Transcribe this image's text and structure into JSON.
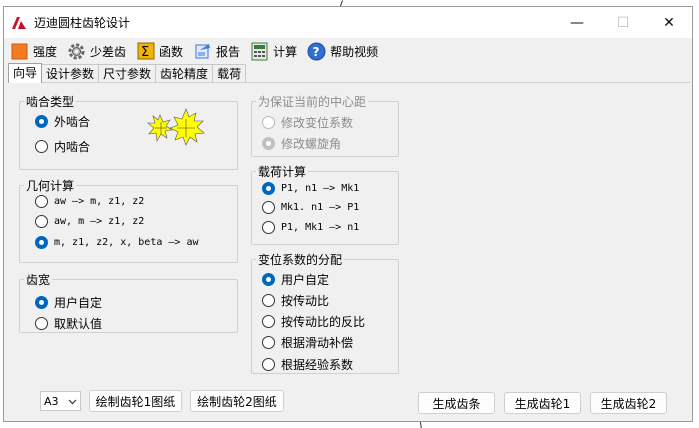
{
  "window": {
    "title": "迈迪圆柱齿轮设计",
    "minimize": "—",
    "maximize": "☐",
    "close": "✕"
  },
  "menu": {
    "items": [
      {
        "label": "强度",
        "icon": "orange-square-icon",
        "color": "#f47c20"
      },
      {
        "label": "少差齿",
        "icon": "gear-icon",
        "color": "#7a7a7a"
      },
      {
        "label": "函数",
        "icon": "sigma-icon",
        "color": "#f2b400"
      },
      {
        "label": "报告",
        "icon": "report-icon",
        "color": "#3c78d8"
      },
      {
        "label": "计算",
        "icon": "calculator-icon",
        "color": "#3a7d3a"
      },
      {
        "label": "帮助视频",
        "icon": "help-icon",
        "color": "#2e6fd1"
      }
    ]
  },
  "tabs": [
    {
      "label": "向导",
      "active": true
    },
    {
      "label": "设计参数",
      "active": false
    },
    {
      "label": "尺寸参数",
      "active": false
    },
    {
      "label": "齿轮精度",
      "active": false
    },
    {
      "label": "载荷",
      "active": false
    }
  ],
  "groups": {
    "mesh_type": {
      "title": "啮合类型",
      "options": [
        {
          "label": "外啮合",
          "checked": true
        },
        {
          "label": "内啮合",
          "checked": false
        }
      ]
    },
    "geometry": {
      "title": "几何计算",
      "options": [
        {
          "label": "aw —> m, z1, z2",
          "checked": false
        },
        {
          "label": "aw, m —> z1, z2",
          "checked": false
        },
        {
          "label": "m, z1, z2, x, beta —> aw",
          "checked": true
        }
      ]
    },
    "tooth_width": {
      "title": "齿宽",
      "options": [
        {
          "label": "用户自定",
          "checked": true
        },
        {
          "label": "取默认值",
          "checked": false
        }
      ]
    },
    "center_distance": {
      "title": "为保证当前的中心距",
      "options": [
        {
          "label": "修改变位系数",
          "checked": false
        },
        {
          "label": "修改螺旋角",
          "checked": true
        }
      ]
    },
    "load": {
      "title": "载荷计算",
      "options": [
        {
          "label": "P1, n1 —> Mk1",
          "checked": true
        },
        {
          "label": "Mk1. n1 —> P1",
          "checked": false
        },
        {
          "label": "P1, Mk1 —> n1",
          "checked": false
        }
      ]
    },
    "shift": {
      "title": "变位系数的分配",
      "options": [
        {
          "label": "用户自定",
          "checked": true
        },
        {
          "label": "按传动比",
          "checked": false
        },
        {
          "label": "按传动比的反比",
          "checked": false
        },
        {
          "label": "根据滑动补偿",
          "checked": false
        },
        {
          "label": "根据经验系数",
          "checked": false
        }
      ]
    }
  },
  "bottom": {
    "paper_size": "A3",
    "draw_gear1": "绘制齿轮1图纸",
    "draw_gear2": "绘制齿轮2图纸",
    "gen_rack": "生成齿条",
    "gen_gear1": "生成齿轮1",
    "gen_gear2": "生成齿轮2"
  },
  "colors": {
    "accent": "#0067c0",
    "gear_highlight": "#ffff00"
  }
}
